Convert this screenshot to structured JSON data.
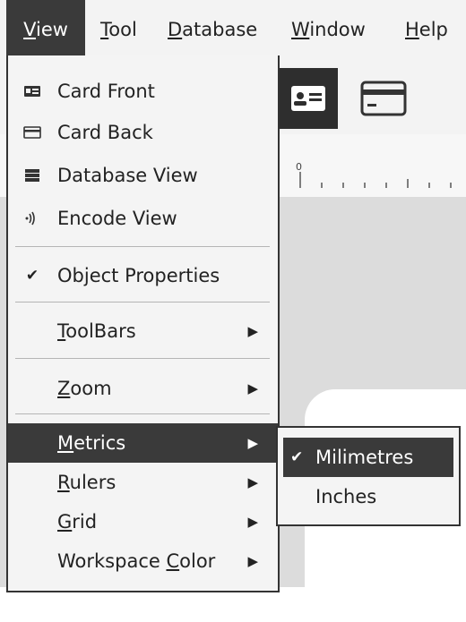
{
  "menubar": {
    "view": {
      "pre": "",
      "ul": "V",
      "post": "iew"
    },
    "tool": {
      "pre": "",
      "ul": "T",
      "post": "ool"
    },
    "database": {
      "pre": "",
      "ul": "D",
      "post": "atabase"
    },
    "window": {
      "pre": "",
      "ul": "W",
      "post": "indow"
    },
    "help": {
      "pre": "",
      "ul": "H",
      "post": "elp"
    }
  },
  "view_menu": {
    "card_front": "Card Front",
    "card_back": "Card Back",
    "database_view": "Database View",
    "encode_view": "Encode View",
    "object_properties": "Object Properties",
    "toolbars": {
      "pre": "",
      "ul": "T",
      "post": "oolBars"
    },
    "zoom": {
      "pre": "",
      "ul": "Z",
      "post": "oom"
    },
    "metrics": {
      "pre": "",
      "ul": "M",
      "post": "etrics"
    },
    "rulers": {
      "pre": "",
      "ul": "R",
      "post": "ulers"
    },
    "grid": {
      "pre": "",
      "ul": "G",
      "post": "rid"
    },
    "workspace_color": {
      "pre": "Workspace ",
      "ul": "C",
      "post": "olor"
    }
  },
  "metrics_submenu": {
    "milimetres": "Milimetres",
    "inches": "Inches"
  },
  "ruler": {
    "zero": "0"
  },
  "icons": {
    "card_front": "id-card-icon",
    "card_back": "card-back-icon",
    "database_view": "database-icon",
    "encode_view": "encode-icon",
    "check": "checkmark-icon",
    "submenu_arrow": "triangle-right-icon"
  },
  "colors": {
    "highlight": "#3a3a3a",
    "menu_bg": "#f4f4f4",
    "workspace": "#dcdcdc"
  }
}
